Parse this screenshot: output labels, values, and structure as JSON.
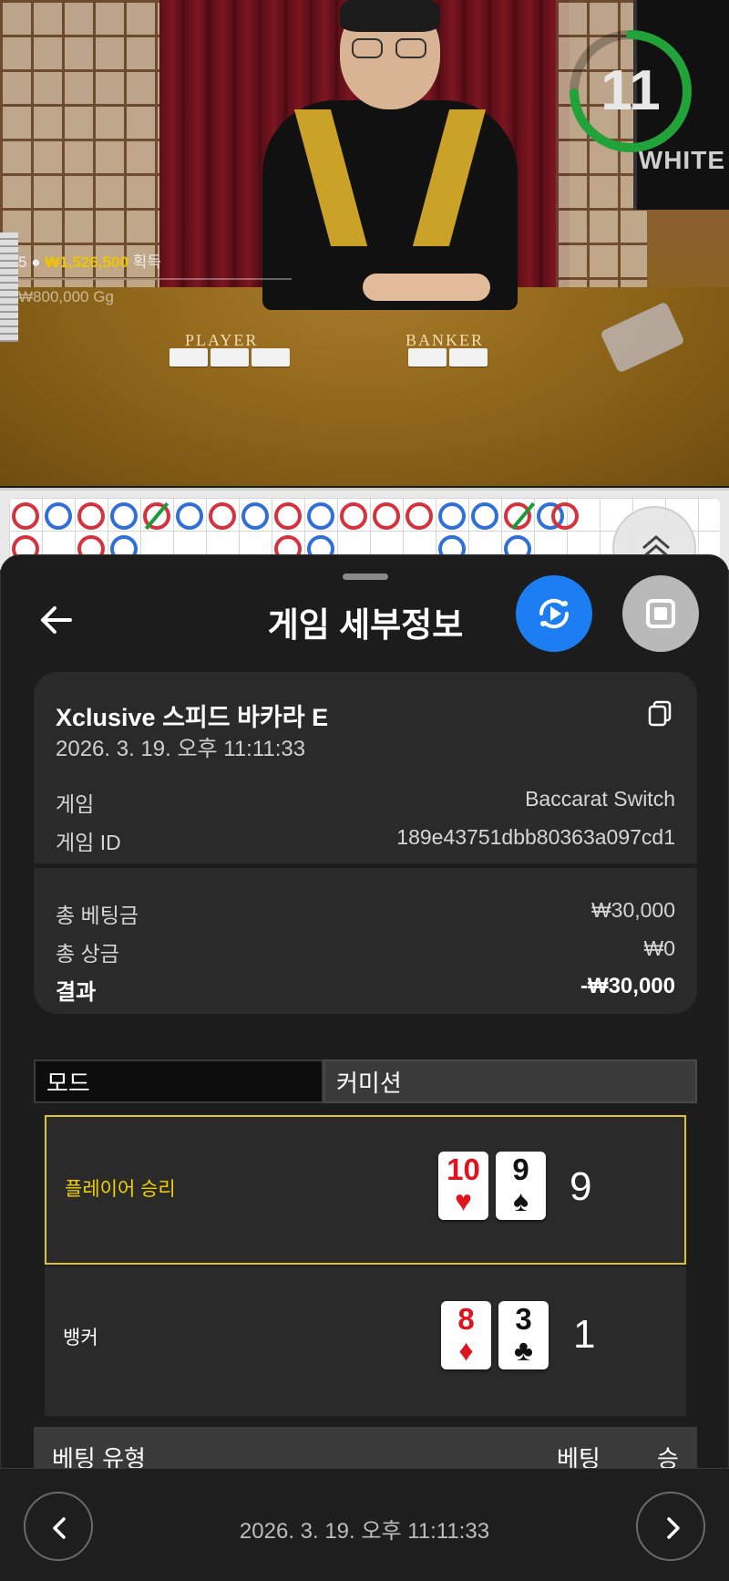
{
  "video": {
    "players_count": "5",
    "won_amount": "₩1,526,500",
    "won_label": "획득",
    "limit_text": "₩800,000 Gg",
    "player_label": "PLAYER",
    "banker_label": "BANKER",
    "timer": "11",
    "monitor_text": "WHITE"
  },
  "sheet": {
    "title": "게임 세부정보",
    "game": {
      "name": "Xclusive 스피드 바카라 E",
      "datetime": "2026. 3. 19. 오후 11:11:33",
      "game_label": "게임",
      "game_value": "Baccarat Switch",
      "id_label": "게임 ID",
      "id_value": "189e43751dbb80363a097cd1"
    },
    "summary": {
      "total_bet_label": "총 베팅금",
      "total_bet_value": "₩30,000",
      "total_win_label": "총 상금",
      "total_win_value": "₩0",
      "result_label": "결과",
      "result_value": "-₩30,000"
    },
    "tabs": {
      "mode": "모드",
      "commission": "커미션"
    },
    "hands": {
      "player": {
        "label": "플레이어 승리",
        "card1_rank": "10",
        "card1_suit": "♥",
        "card2_rank": "9",
        "card2_suit": "♠",
        "total": "9"
      },
      "banker": {
        "label": "뱅커",
        "card1_rank": "8",
        "card1_suit": "♦",
        "card2_rank": "3",
        "card2_suit": "♣",
        "total": "1"
      }
    },
    "bet_table": {
      "col_type": "베팅 유형",
      "col_bet": "베팅",
      "col_win": "승"
    },
    "footer_datetime": "2026. 3. 19. 오후 11:11:33"
  },
  "colors": {
    "accent_blue": "#1c7ef2",
    "win_yellow": "#f0d000",
    "timer_green": "#22a33a",
    "bead_blue": "#2f6fd9",
    "bead_red": "#d9313b"
  }
}
